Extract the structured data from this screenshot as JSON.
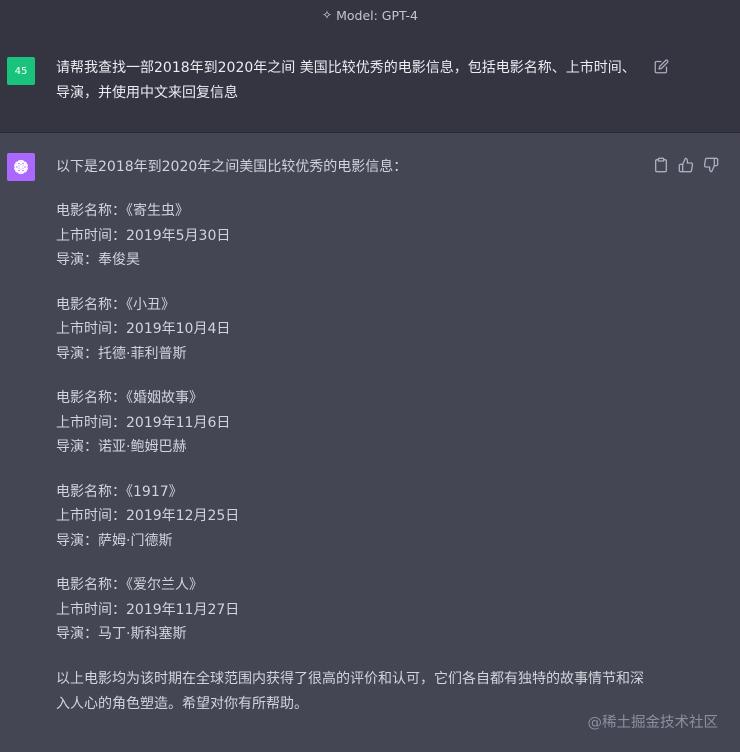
{
  "header": {
    "model_label": "Model: GPT-4",
    "icon": "sparkle-icon"
  },
  "user_message": {
    "avatar_label": "45",
    "text": "请帮我查找一部2018年到2020年之间 美国比较优秀的电影信息，包括电影名称、上市时间、导演，并使用中文来回复信息",
    "edit_icon": "edit-icon",
    "avatar_color": "#19c37d"
  },
  "assistant_message": {
    "avatar_icon": "openai-logo-icon",
    "avatar_color": "#ab68ff",
    "intro": "以下是2018年到2020年之间美国比较优秀的电影信息：",
    "movies": [
      {
        "name": "电影名称：《寄生虫》",
        "date": "上市时间：2019年5月30日",
        "director": "导演：奉俊昊"
      },
      {
        "name": "电影名称：《小丑》",
        "date": "上市时间：2019年10月4日",
        "director": "导演：托德·菲利普斯"
      },
      {
        "name": "电影名称：《婚姻故事》",
        "date": "上市时间：2019年11月6日",
        "director": "导演：诺亚·鲍姆巴赫"
      },
      {
        "name": "电影名称：《1917》",
        "date": "上市时间：2019年12月25日",
        "director": "导演：萨姆·门德斯"
      },
      {
        "name": "电影名称：《爱尔兰人》",
        "date": "上市时间：2019年11月27日",
        "director": "导演：马丁·斯科塞斯"
      }
    ],
    "outro": "以上电影均为该时期在全球范围内获得了很高的评价和认可，它们各自都有独特的故事情节和深入人心的角色塑造。希望对你有所帮助。",
    "actions": [
      "copy-icon",
      "thumbs-up-icon",
      "thumbs-down-icon"
    ]
  },
  "watermark": "@稀土掘金技术社区"
}
